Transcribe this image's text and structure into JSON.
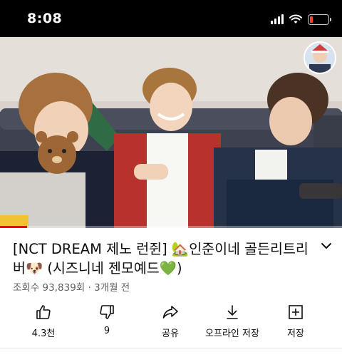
{
  "status_bar": {
    "time": "8:08",
    "battery_level": 0.15,
    "battery_color": "#ff3b30",
    "icons": [
      "cellular-signal-icon",
      "wifi-icon",
      "battery-icon"
    ]
  },
  "video": {
    "progress": 0.08,
    "progress_color": "#ff0000",
    "channel_avatar_icon": "channel-avatar"
  },
  "video_info": {
    "title": "[NCT DREAM 제노 런쥔] 🏡인준이네 골든리트리버🐶 (시즈니네 젠모예드💚)",
    "meta": "조회수 93,839회 · 3개월 전",
    "expand_icon": "chevron-down-icon"
  },
  "actions": [
    {
      "icon": "thumbs-up-icon",
      "label": "4.3천"
    },
    {
      "icon": "thumbs-down-icon",
      "label": "9"
    },
    {
      "icon": "share-icon",
      "label": "공유"
    },
    {
      "icon": "download-icon",
      "label": "오프라인 저장"
    },
    {
      "icon": "save-to-playlist-icon",
      "label": "저장"
    }
  ]
}
